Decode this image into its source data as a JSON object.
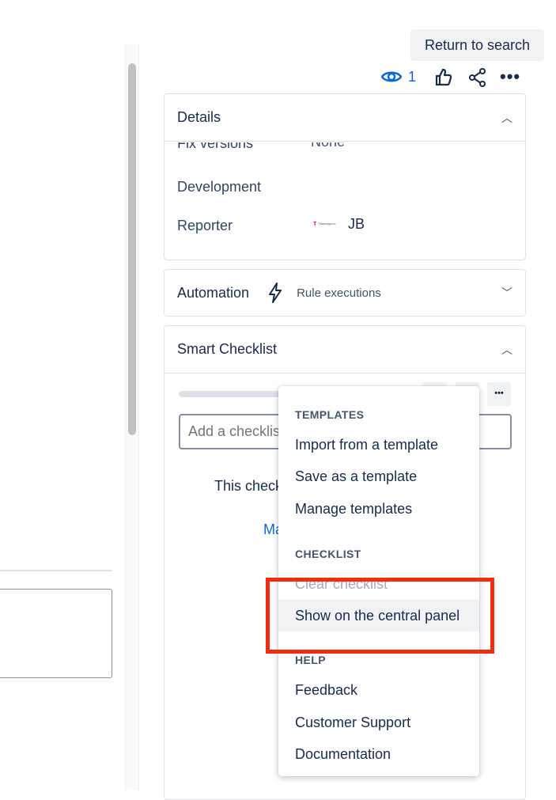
{
  "header": {
    "return_label": "Return to search",
    "watch_count": "1"
  },
  "details": {
    "title": "Details",
    "fields": [
      {
        "label": "Fix versions",
        "value": "None"
      },
      {
        "label": "Development",
        "value": ""
      },
      {
        "label": "Reporter",
        "value": "JB",
        "avatar_text": "TitanApps.io"
      }
    ]
  },
  "automation": {
    "title": "Automation",
    "link": "Rule executions"
  },
  "checklist": {
    "title": "Smart Checklist",
    "input_placeholder": "Add a checklist item",
    "empty_text": "This checkl",
    "link_text": "Ma"
  },
  "menu": {
    "sections": [
      {
        "heading": "TEMPLATES",
        "items": [
          "Import from a template",
          "Save as a template",
          "Manage templates"
        ]
      },
      {
        "heading": "CHECKLIST",
        "items": [
          "Clear checklist",
          "Show on the central panel"
        ]
      },
      {
        "heading": "HELP",
        "items": [
          "Feedback",
          "Customer Support",
          "Documentation"
        ]
      }
    ]
  },
  "colors": {
    "highlight": "#f52a0f",
    "link": "#0c66e4"
  }
}
